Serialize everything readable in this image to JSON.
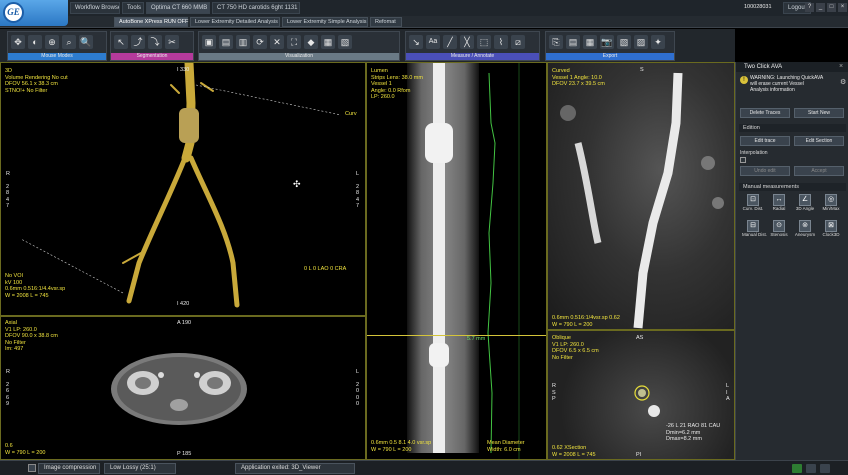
{
  "titlebar": {
    "logo_text": "GE",
    "tabs": [
      "Workflow Browser",
      "Tools",
      "Optima CT 660 MMB",
      "CT 750 HD carotids 6ght 1131"
    ],
    "user": "100028031",
    "logout": "Logout",
    "window_controls": [
      "?",
      "_",
      "□",
      "×"
    ]
  },
  "protocol_tabs": [
    "AutoBone XPress RUN OFF",
    "Lower Extremity Detailed Analysis",
    "Lower Extremity Simple Analysis",
    "Refomat"
  ],
  "toolbar": {
    "groups": [
      {
        "label": "Mouse Modes",
        "icons": [
          "✥",
          "◐",
          "⊕",
          "⌕",
          "🔍"
        ]
      },
      {
        "label": "Segmentation",
        "icons": [
          "↖",
          "⤴",
          "⤵",
          "✂"
        ]
      },
      {
        "label": "Visualization",
        "icons": [
          "▣",
          "▤",
          "▥",
          "⟳",
          "✕",
          "⛶",
          "◆",
          "▦",
          "▧"
        ]
      },
      {
        "label": "Measure / Annotate",
        "icons": [
          "↘",
          "Aa",
          "╱",
          "╳",
          "⬚",
          "⌇",
          "⧄"
        ]
      },
      {
        "label": "Export",
        "icons": [
          "⎘",
          "▤",
          "▦",
          "📷",
          "▧",
          "▨",
          "✦"
        ]
      }
    ]
  },
  "vp3d": {
    "lines": [
      "3D",
      "Volume Rendering No cut",
      "DFOV 56.1 x 38.3 cm",
      "STNO!+ No Filter"
    ],
    "top_marker": "I 330",
    "left_marks": [
      "R",
      "2",
      "8",
      "4",
      "7"
    ],
    "right_marks": [
      "L",
      "2",
      "8",
      "4",
      "7"
    ],
    "bottom_lines": [
      "No VOI",
      "kV 100",
      "0.6mm 0.516:1/4.4vsr.sp",
      "W = 2008 L = 745"
    ],
    "bottom_marker": "I 420",
    "orientation": "0 L 0 LAO 0 CRA",
    "label_right": "Curv"
  },
  "vplumen": {
    "lines": [
      "Lumen",
      "Strips Lens: 38.0 mm",
      "Vessel 1",
      "Angle: 0.0 Rfom",
      "LP: 260.0"
    ],
    "bottom_lines": [
      "0.6mm 0.5 8.1 4.0 vsr.sp",
      "W = 790 L = 200"
    ],
    "diameter_label": "Mean Diameter",
    "width_label": "Width: 6.0 cm",
    "marker": "5.7 mm"
  },
  "vpcurved": {
    "lines": [
      "Curved",
      "Vessel 1 Angle: 10.0",
      "DFOV 23.7 x 39.5 cm"
    ],
    "top_marker": "S",
    "bottom_lines": [
      "0.6mm 0.516:1/4vsr.sp 0.62",
      "W = 790 L = 200"
    ]
  },
  "vpaxial": {
    "lines": [
      "Axial",
      "V1 LP: 260.0",
      "DFOV 90.0 x 38.8 cm",
      "No Filter",
      "Im: 497"
    ],
    "top_marker": "A 190",
    "left_marks": [
      "R",
      "2",
      "6",
      "6",
      "9"
    ],
    "right_marks": [
      "L",
      "2",
      "0",
      "0",
      "0"
    ],
    "bottom_lines": [
      "0.6",
      "W = 790 L = 200"
    ],
    "bottom_marker": "P 185"
  },
  "vpoblique": {
    "lines": [
      "Oblique",
      "V1 LP: 260.0",
      "DFOV 6.5 x 6.5 cm",
      "No Filter"
    ],
    "top_marker": "AS",
    "left_marks": [
      "R",
      "S",
      "P"
    ],
    "right_marks": [
      "L",
      "I",
      "A"
    ],
    "measure_lines": [
      "-26 L 21 RAO 81 CAU",
      "Dmin=6.2 mm",
      "Dmax=8.2 mm"
    ],
    "bottom_lines": [
      "0.62 XSection",
      "W = 2008 L = 745"
    ],
    "bottom_marker": "PI"
  },
  "rpanel": {
    "title": "Two Click AVA",
    "warning": [
      "WARNING: Launching QuickAVA",
      "will erase current Vessel",
      "Analysis information"
    ],
    "buttons_top": [
      "Delete Traces",
      "Start New"
    ],
    "edition": "Edition",
    "edit_buttons": [
      "Edit trace",
      "Edit Section"
    ],
    "interpolation": "Interpolation",
    "undo_buttons": [
      "Undo edit",
      "Accept"
    ],
    "manual": "Manual measurements",
    "measure_tools": [
      {
        "icon": "⊡",
        "label": "Curv. Dist."
      },
      {
        "icon": "↔",
        "label": "Radial"
      },
      {
        "icon": "∠",
        "label": "3D Angle"
      },
      {
        "icon": "◎",
        "label": "Min/Max"
      },
      {
        "icon": "⊟",
        "label": "Manual Dist."
      },
      {
        "icon": "⊙",
        "label": "Stenosis"
      },
      {
        "icon": "⊚",
        "label": "Aneurysm"
      },
      {
        "icon": "⊠",
        "label": "Clock3D"
      }
    ]
  },
  "taskbar": {
    "items": [
      "Image compression",
      "Low Lossy (25:1)",
      "Application exited: 3D_Viewer"
    ],
    "indicators": [
      "",
      "",
      ""
    ]
  }
}
